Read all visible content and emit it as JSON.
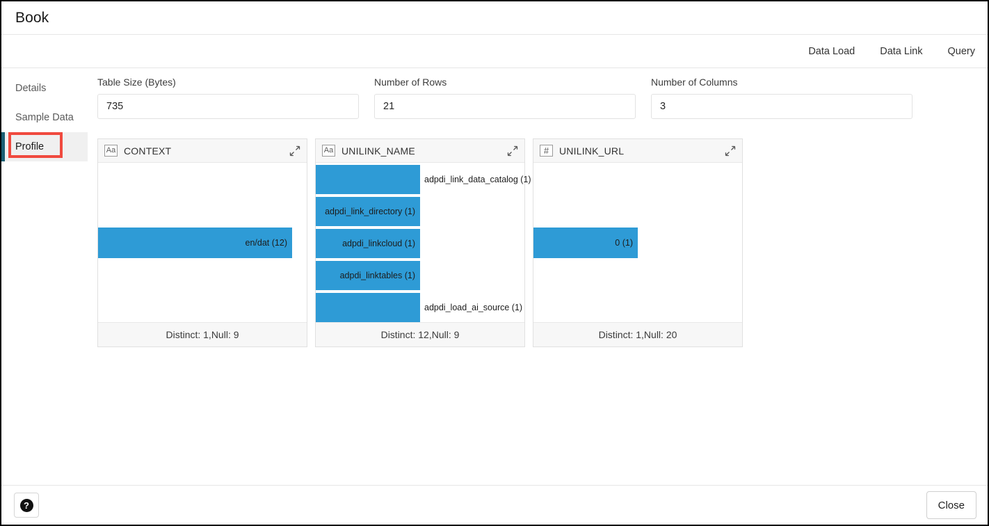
{
  "window": {
    "title": "Book"
  },
  "nav": {
    "items": [
      {
        "label": "Data Load"
      },
      {
        "label": "Data Link"
      },
      {
        "label": "Query"
      }
    ]
  },
  "sidebar": {
    "items": [
      {
        "label": "Details",
        "selected": false
      },
      {
        "label": "Sample Data",
        "selected": false
      },
      {
        "label": "Profile",
        "selected": true
      }
    ],
    "annotation_color": "#f04a3f",
    "accent_color": "#1a5e73"
  },
  "summary": {
    "fields": [
      {
        "label": "Table Size (Bytes)",
        "value": "735",
        "placeholder": ""
      },
      {
        "label": "Number of Rows",
        "value": "21",
        "placeholder": ""
      },
      {
        "label": "Number of Columns",
        "value": "3",
        "placeholder": ""
      }
    ]
  },
  "profile": {
    "bar_color": "#2e9bd6",
    "cards": [
      {
        "name": "CONTEXT",
        "type_icon": "text-type-icon",
        "type_glyph": "Aa",
        "expand_icon": "expand-diagonal-icon",
        "footer": "Distinct: 1,Null: 9",
        "distinct": 1,
        "null": 9,
        "bars": [
          {
            "label": "en/dat (12)",
            "value": "en/dat",
            "count": 12,
            "width_pct": 93,
            "label_inside": true
          }
        ]
      },
      {
        "name": "UNILINK_NAME",
        "type_icon": "text-type-icon",
        "type_glyph": "Aa",
        "expand_icon": "expand-diagonal-icon",
        "footer": "Distinct: 12,Null: 9",
        "distinct": 12,
        "null": 9,
        "bars": [
          {
            "label": "adpdi_link_data_catalog (1)",
            "value": "adpdi_link_data_catalog",
            "count": 1,
            "width_pct": 50,
            "label_inside": false
          },
          {
            "label": "adpdi_link_directory (1)",
            "value": "adpdi_link_directory",
            "count": 1,
            "width_pct": 50,
            "label_inside": true
          },
          {
            "label": "adpdi_linkcloud (1)",
            "value": "adpdi_linkcloud",
            "count": 1,
            "width_pct": 50,
            "label_inside": true
          },
          {
            "label": "adpdi_linktables (1)",
            "value": "adpdi_linktables",
            "count": 1,
            "width_pct": 50,
            "label_inside": true
          },
          {
            "label": "adpdi_load_ai_source (1)",
            "value": "adpdi_load_ai_source",
            "count": 1,
            "width_pct": 50,
            "label_inside": false
          }
        ]
      },
      {
        "name": "UNILINK_URL",
        "type_icon": "number-type-icon",
        "type_glyph": "#",
        "expand_icon": "expand-diagonal-icon",
        "footer": "Distinct: 1,Null: 20",
        "distinct": 1,
        "null": 20,
        "bars": [
          {
            "label": "0 (1)",
            "value": "0",
            "count": 1,
            "width_pct": 50,
            "label_inside": true
          }
        ]
      }
    ]
  },
  "footer": {
    "help_label": "?",
    "close_label": "Close"
  },
  "chart_data": [
    {
      "type": "bar",
      "title": "CONTEXT",
      "orientation": "horizontal",
      "categories": [
        "en/dat"
      ],
      "values": [
        12
      ],
      "xlabel": "",
      "ylabel": "",
      "grid": false,
      "legend": "none",
      "annotations": [
        "Distinct: 1,Null: 9"
      ]
    },
    {
      "type": "bar",
      "title": "UNILINK_NAME",
      "orientation": "horizontal",
      "categories": [
        "adpdi_link_data_catalog",
        "adpdi_link_directory",
        "adpdi_linkcloud",
        "adpdi_linktables",
        "adpdi_load_ai_source"
      ],
      "values": [
        1,
        1,
        1,
        1,
        1
      ],
      "xlabel": "",
      "ylabel": "",
      "grid": false,
      "legend": "none",
      "annotations": [
        "Distinct: 12,Null: 9"
      ]
    },
    {
      "type": "bar",
      "title": "UNILINK_URL",
      "orientation": "horizontal",
      "categories": [
        "0"
      ],
      "values": [
        1
      ],
      "xlabel": "",
      "ylabel": "",
      "grid": false,
      "legend": "none",
      "annotations": [
        "Distinct: 1,Null: 20"
      ]
    }
  ]
}
